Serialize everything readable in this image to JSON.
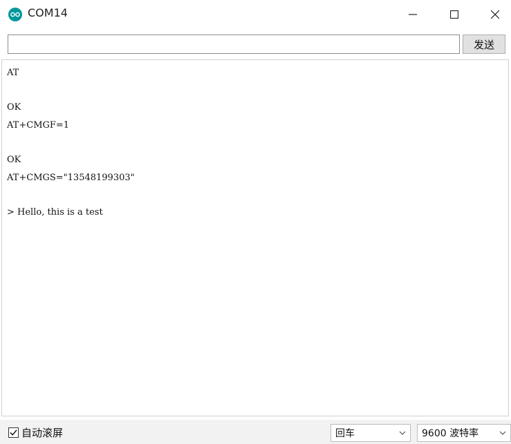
{
  "window": {
    "title": "COM14",
    "icon": "arduino-icon",
    "accent_color": "#00979c"
  },
  "toolbar": {
    "input_value": "",
    "send_label": "发送"
  },
  "output": {
    "lines": [
      "AT",
      "",
      "OK",
      "AT+CMGF=1",
      "",
      "OK",
      "AT+CMGS=\"13548199303\"",
      "",
      "> Hello, this is a test"
    ]
  },
  "statusbar": {
    "autoscroll_label": "自动滚屏",
    "autoscroll_checked": true,
    "line_ending": "回车",
    "baud_rate": "9600 波特率"
  }
}
